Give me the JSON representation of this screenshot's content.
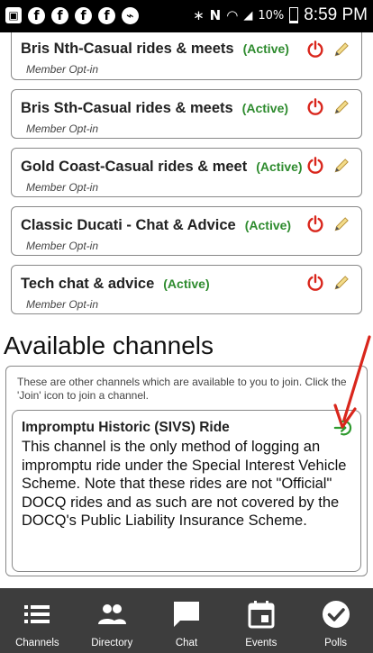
{
  "status_bar": {
    "battery": "10%",
    "time": "8:59 PM"
  },
  "subscribed_channels": [
    {
      "title": "Bris Nth-Casual rides & meets",
      "status": "(Active)",
      "subtitle": "Member Opt-in"
    },
    {
      "title": "Bris Sth-Casual rides & meets",
      "status": "(Active)",
      "subtitle": "Member Opt-in"
    },
    {
      "title": "Gold Coast-Casual rides & meet",
      "status": "(Active)",
      "subtitle": "Member Opt-in"
    },
    {
      "title": "Classic Ducati - Chat & Advice",
      "status": "(Active)",
      "subtitle": "Member Opt-in"
    },
    {
      "title": "Tech chat & advice",
      "status": "(Active)",
      "subtitle": "Member Opt-in"
    }
  ],
  "available": {
    "heading": "Available channels",
    "description": "These are other channels which are available to you to join. Click the 'Join' icon to join a channel.",
    "channel": {
      "title": "Impromptu Historic (SIVS) Ride",
      "text": "This channel is the only method of logging an impromptu ride under the Special Interest Vehicle Scheme. Note that these rides are not \"Official\" DOCQ rides and as such are not covered by the DOCQ's Public Liability Insurance Scheme."
    }
  },
  "nav": [
    {
      "label": "Channels",
      "icon": "list-icon"
    },
    {
      "label": "Directory",
      "icon": "people-icon"
    },
    {
      "label": "Chat",
      "icon": "chat-icon"
    },
    {
      "label": "Events",
      "icon": "calendar-icon"
    },
    {
      "label": "Polls",
      "icon": "check-circle-icon"
    }
  ],
  "colors": {
    "active_green": "#2e8b2e",
    "power_red": "#d9261c",
    "annotation_arrow": "#d9261c",
    "nav_background": "#3d3d3d"
  }
}
